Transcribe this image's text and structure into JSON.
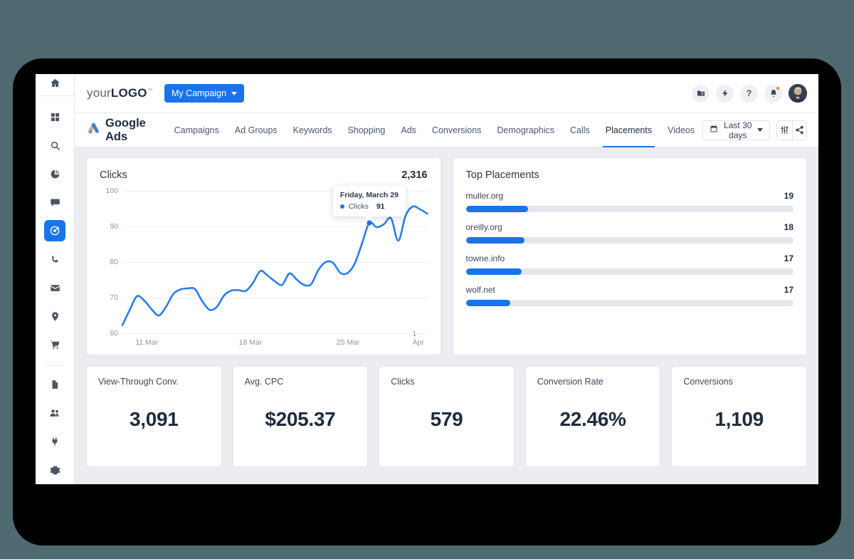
{
  "rail": {
    "home_icon": "home-icon",
    "items": [
      {
        "icon": "grid-icon",
        "name": "dashboard",
        "active": false
      },
      {
        "icon": "search-icon",
        "name": "search",
        "active": false
      },
      {
        "icon": "pie-chart-icon",
        "name": "analytics",
        "active": false
      },
      {
        "icon": "chat-bubble-icon",
        "name": "messages",
        "active": false
      },
      {
        "icon": "target-icon",
        "name": "campaigns",
        "active": true
      },
      {
        "icon": "phone-icon",
        "name": "calls",
        "active": false
      },
      {
        "icon": "mail-icon",
        "name": "email",
        "active": false
      },
      {
        "icon": "location-pin-icon",
        "name": "locations",
        "active": false
      },
      {
        "icon": "shopping-cart-icon",
        "name": "shopping",
        "active": false
      },
      {
        "icon": "document-icon",
        "name": "reports",
        "active": false
      },
      {
        "icon": "users-icon",
        "name": "audiences",
        "active": false
      },
      {
        "icon": "plug-icon",
        "name": "integrations",
        "active": false
      },
      {
        "icon": "gear-icon",
        "name": "settings",
        "active": false
      }
    ]
  },
  "header": {
    "logo_prefix": "your",
    "logo_bold": "LOGO",
    "logo_tm": "™",
    "campaign_label": "My Campaign",
    "icons": [
      {
        "name": "folder-icon",
        "glyph": "folder"
      },
      {
        "name": "lightning-bolt-icon",
        "glyph": "bolt"
      },
      {
        "name": "help-icon",
        "glyph": "?"
      },
      {
        "name": "bell-icon",
        "glyph": "bell",
        "badge": true
      }
    ],
    "avatar_name": "user-avatar"
  },
  "tabbar": {
    "brand": "Google Ads",
    "tabs": [
      {
        "label": "Campaigns",
        "active": false
      },
      {
        "label": "Ad Groups",
        "active": false
      },
      {
        "label": "Keywords",
        "active": false
      },
      {
        "label": "Shopping",
        "active": false
      },
      {
        "label": "Ads",
        "active": false
      },
      {
        "label": "Conversions",
        "active": false
      },
      {
        "label": "Demographics",
        "active": false
      },
      {
        "label": "Calls",
        "active": false
      },
      {
        "label": "Placements",
        "active": true
      },
      {
        "label": "Videos",
        "active": false
      }
    ],
    "date_range": "Last 30 days",
    "controls": [
      {
        "name": "filter-settings-icon"
      },
      {
        "name": "share-icon"
      }
    ]
  },
  "chart_card": {
    "title": "Clicks",
    "total": "2,316"
  },
  "chart_data": {
    "type": "line",
    "title": "Clicks",
    "xlabel": "",
    "ylabel": "",
    "ylim": [
      60,
      100
    ],
    "yticks": [
      60,
      70,
      80,
      90,
      100
    ],
    "grid": true,
    "legend": "hidden",
    "x_tick_labels": [
      "11 Mar",
      "18 Mar",
      "25 Mar",
      "1 Apr"
    ],
    "x_tick_positions": [
      0.08,
      0.42,
      0.74,
      0.97
    ],
    "series": [
      {
        "name": "Clicks",
        "color": "#2b7de9",
        "values": [
          62.3,
          66.5,
          70.4,
          69.2,
          66.8,
          65.0,
          67.4,
          71.0,
          72.3,
          72.6,
          72.4,
          69.0,
          66.6,
          67.4,
          70.6,
          72.0,
          72.1,
          71.9,
          74.2,
          77.5,
          76.2,
          74.6,
          73.6,
          76.8,
          75.1,
          73.6,
          73.8,
          77.8,
          80.0,
          79.8,
          77.0,
          76.9,
          79.6,
          85.2,
          91.0,
          89.8,
          90.6,
          92.3,
          86.0,
          93.0,
          95.6,
          94.8,
          93.6
        ]
      }
    ],
    "tooltip": {
      "date": "Friday, March 29",
      "series_label": "Clicks",
      "value": "91",
      "point_index": 34
    }
  },
  "placements_card": {
    "title": "Top Placements",
    "max_value": 100,
    "items": [
      {
        "name": "muller.org",
        "value": "19",
        "pct": 19
      },
      {
        "name": "oreilly.org",
        "value": "18",
        "pct": 18
      },
      {
        "name": "towne.info",
        "value": "17",
        "pct": 17
      },
      {
        "name": "wolf.net",
        "value": "17",
        "pct": 13.5
      }
    ]
  },
  "kpis": [
    {
      "label": "View-Through Conv.",
      "value": "3,091"
    },
    {
      "label": "Avg. CPC",
      "value": "$205.37"
    },
    {
      "label": "Clicks",
      "value": "579"
    },
    {
      "label": "Conversion Rate",
      "value": "22.46%"
    },
    {
      "label": "Conversions",
      "value": "1,109"
    }
  ],
  "colors": {
    "accent": "#1a73e8",
    "line": "#2b7de9",
    "page_bg": "#ebedf0",
    "text_dark": "#1f2b3d",
    "backdrop": "#4e6a70"
  }
}
